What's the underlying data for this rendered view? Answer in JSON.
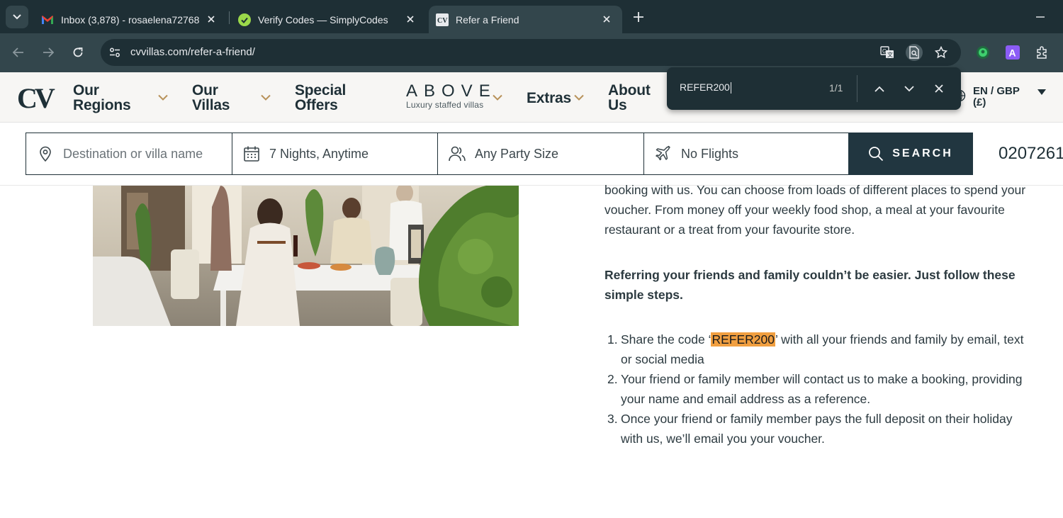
{
  "browser": {
    "tabs": [
      {
        "title": "Inbox (3,878) - rosaelena72768",
        "favicon": "gmail-icon",
        "active": false
      },
      {
        "title": "Verify Codes — SimplyCodes",
        "favicon": "simplycodes-icon",
        "active": false
      },
      {
        "title": "Refer a Friend",
        "favicon": "cv-villas-icon",
        "active": true
      }
    ],
    "url": "cvvillas.com/refer-a-friend/",
    "extension_letter": "A"
  },
  "find_bar": {
    "query": "REFER200",
    "count": "1/1"
  },
  "site": {
    "logo": "CV",
    "nav": [
      {
        "line1": "Our",
        "line2": "Regions"
      },
      {
        "line1": "Our",
        "line2": "Villas"
      },
      {
        "line1": "Special",
        "line2": "Offers"
      },
      {
        "line1": "Extras",
        "line2": ""
      },
      {
        "line1": "About",
        "line2": "Us"
      }
    ],
    "above": {
      "word": "ABOVE",
      "tagline": "Luxury staffed villas"
    },
    "language": {
      "line1": "EN / GBP",
      "line2": "(£)"
    },
    "search": {
      "destination_placeholder": "Destination or villa name",
      "dates": "7 Nights, Anytime",
      "party": "Any Party Size",
      "flights": "No Flights",
      "button": "SEARCH"
    },
    "phone": "0207261"
  },
  "content": {
    "paragraph1": "booking with us. You can choose from loads of different places to spend your voucher. From money off your weekly food shop, a meal at your favourite restaurant or a treat from your favourite store.",
    "paragraph2": "Referring your friends and family couldn’t be easier. Just follow these simple steps.",
    "steps": [
      {
        "num": "1.",
        "before": "Share the code ‘",
        "code": "REFER200",
        "after": "’ with all your friends and family by email, text or social media"
      },
      {
        "num": "2.",
        "text": "Your friend or family member will contact us to make a booking, providing your name and email address as a reference."
      },
      {
        "num": "3.",
        "text": "Once your friend or family member pays the full deposit on their holiday with us, we’ll email you your voucher."
      }
    ]
  },
  "colors": {
    "chrome_dark": "#1e2f35",
    "chrome_mid": "#33464c",
    "brand_navy": "#213640",
    "find_highlight": "#f19f40",
    "accent_gold": "#b8925a"
  }
}
